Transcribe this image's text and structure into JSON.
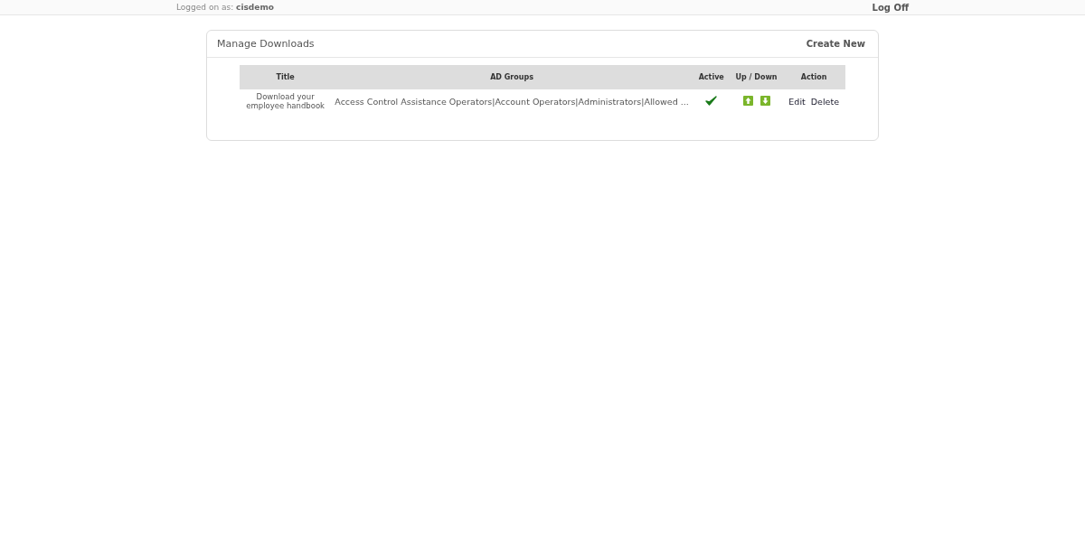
{
  "header": {
    "logged_on_label": "Logged on as:",
    "user": "cisdemo",
    "log_off": "Log Off"
  },
  "panel": {
    "title": "Manage Downloads",
    "create_new": "Create New"
  },
  "table": {
    "columns": [
      "Title",
      "AD Groups",
      "Active",
      "Up / Down",
      "Action"
    ],
    "rows": [
      {
        "title": "Download your employee handbook",
        "ad_groups": "Access Control Assistance Operators|Account Operators|Administrators|Allowed ...",
        "active": true,
        "edit": "Edit",
        "delete": "Delete"
      }
    ]
  }
}
